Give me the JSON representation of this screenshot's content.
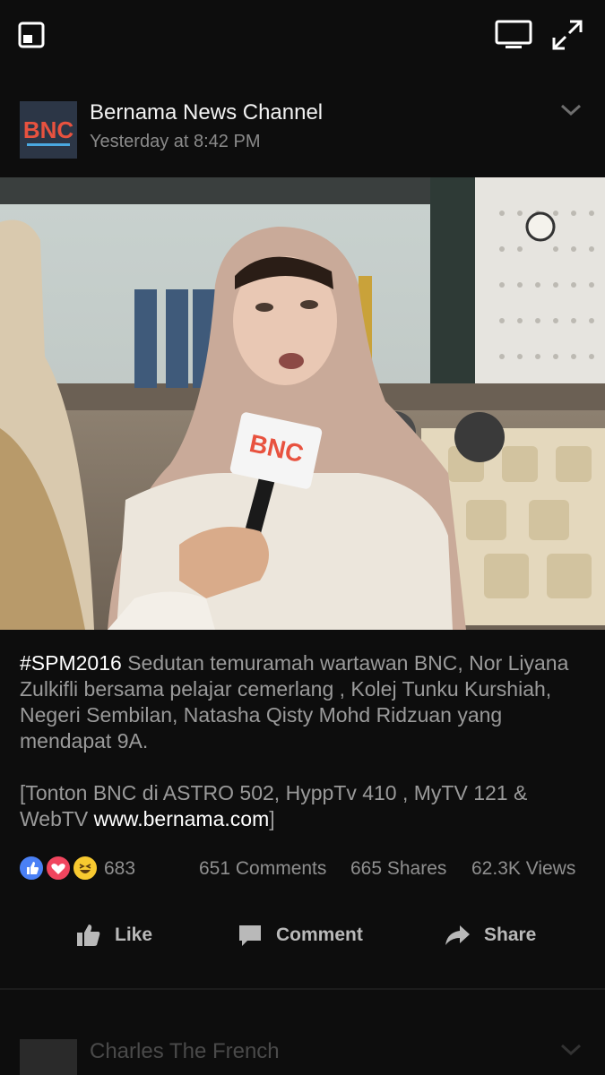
{
  "top_bar": {
    "pip_icon": "picture-in-picture-icon",
    "cast_icon": "tv-screen-icon",
    "fullscreen_icon": "expand-arrows-icon"
  },
  "post": {
    "page_name": "Bernama News Channel",
    "timestamp": "Yesterday at 8:42 PM",
    "avatar_logo_text": "BNC",
    "caption_hashtag": "#SPM2016",
    "caption_text": " Sedutan temuramah wartawan BNC, Nor Liyana Zulkifli bersama pelajar cemerlang , Kolej Tunku Kurshiah, Negeri Sembilan, Natasha Qisty Mohd Ridzuan yang mendapat 9A.",
    "caption_watch_prefix": "[Tonton BNC di ASTRO 502, HyppTv 410 , MyTV 121 & WebTV ",
    "caption_link": "www.bernama.com",
    "caption_watch_suffix": "]"
  },
  "stats": {
    "reactions_count": "683",
    "comments": "651 Comments",
    "shares": "665 Shares",
    "views": "62.3K Views"
  },
  "actions": {
    "like": "Like",
    "comment": "Comment",
    "share": "Share"
  },
  "next_post": {
    "page_name": "Charles The French"
  },
  "colors": {
    "background": "#0d0d0d",
    "like_blue": "#4a80f5",
    "love_red": "#f0455e",
    "haha_yellow": "#f7c930"
  }
}
